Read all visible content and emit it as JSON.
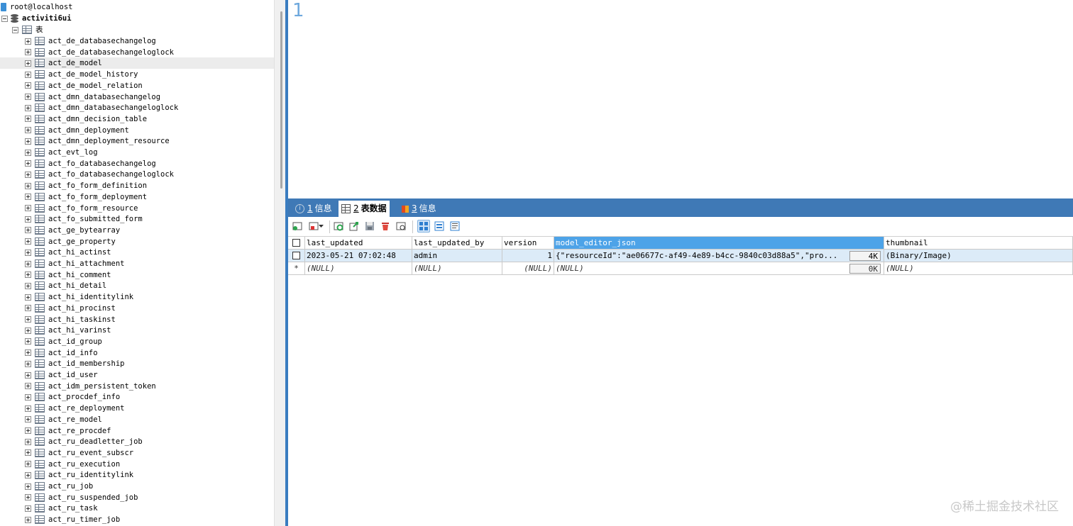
{
  "tree": {
    "connection": "root@localhost",
    "database": "activiti6ui",
    "tables_node": "表",
    "selected_table": "act_de_model",
    "tables": [
      "act_de_databasechangelog",
      "act_de_databasechangeloglock",
      "act_de_model",
      "act_de_model_history",
      "act_de_model_relation",
      "act_dmn_databasechangelog",
      "act_dmn_databasechangeloglock",
      "act_dmn_decision_table",
      "act_dmn_deployment",
      "act_dmn_deployment_resource",
      "act_evt_log",
      "act_fo_databasechangelog",
      "act_fo_databasechangeloglock",
      "act_fo_form_definition",
      "act_fo_form_deployment",
      "act_fo_form_resource",
      "act_fo_submitted_form",
      "act_ge_bytearray",
      "act_ge_property",
      "act_hi_actinst",
      "act_hi_attachment",
      "act_hi_comment",
      "act_hi_detail",
      "act_hi_identitylink",
      "act_hi_procinst",
      "act_hi_taskinst",
      "act_hi_varinst",
      "act_id_group",
      "act_id_info",
      "act_id_membership",
      "act_id_user",
      "act_idm_persistent_token",
      "act_procdef_info",
      "act_re_deployment",
      "act_re_model",
      "act_re_procdef",
      "act_ru_deadletter_job",
      "act_ru_event_subscr",
      "act_ru_execution",
      "act_ru_identitylink",
      "act_ru_job",
      "act_ru_suspended_job",
      "act_ru_task",
      "act_ru_timer_job"
    ]
  },
  "editor": {
    "line_number": "1"
  },
  "tabs": [
    {
      "num": "1",
      "label": "信息",
      "icon": "info-icon"
    },
    {
      "num": "2",
      "label": "表数据",
      "icon": "grid-icon"
    },
    {
      "num": "3",
      "label": "信息",
      "icon": "status-icon"
    }
  ],
  "grid": {
    "columns": [
      "last_updated",
      "last_updated_by",
      "version",
      "model_editor_json",
      "thumbnail"
    ],
    "rows": [
      {
        "last_updated": "2023-05-21 07:02:48",
        "last_updated_by": "admin",
        "version": "1",
        "model_editor_json": "{\"resourceId\":\"ae06677c-af49-4e89-b4cc-9840c03d88a5\",\"pro...",
        "model_editor_json_size": "4K",
        "thumbnail": "(Binary/Image)"
      }
    ],
    "new_row": {
      "marker": "*",
      "last_updated": "(NULL)",
      "last_updated_by": "(NULL)",
      "version": "(NULL)",
      "model_editor_json": "(NULL)",
      "model_editor_json_size": "0K",
      "thumbnail": "(NULL)"
    }
  },
  "watermark": "@稀土掘金技术社区",
  "colors": {
    "tab_bar": "#3f79b6",
    "active_header": "#4da3e8",
    "selected_row": "#dcebf8",
    "editor_border": "#3a7cc0"
  }
}
